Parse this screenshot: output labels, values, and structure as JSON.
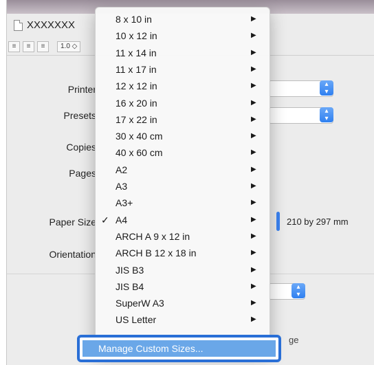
{
  "document": {
    "title": "XXXXXXX"
  },
  "toolbar": {
    "align_icons": [
      "align-left-icon",
      "align-center-icon",
      "align-right-icon"
    ],
    "line_spacing": "1.0 ◇"
  },
  "form": {
    "printer_label": "Printer",
    "presets_label": "Presets",
    "copies_label": "Copies",
    "pages_label": "Pages",
    "paper_size_label": "Paper Size",
    "orientation_label": "Orientation",
    "paper_size_dimensions": "210 by 297 mm",
    "obscured_text": "ge"
  },
  "paper_menu": {
    "items": [
      {
        "label": "8 x 10 in",
        "submenu": true,
        "checked": false
      },
      {
        "label": "10 x 12 in",
        "submenu": true,
        "checked": false
      },
      {
        "label": "11 x 14 in",
        "submenu": true,
        "checked": false
      },
      {
        "label": "11 x 17 in",
        "submenu": true,
        "checked": false
      },
      {
        "label": "12 x 12 in",
        "submenu": true,
        "checked": false
      },
      {
        "label": "16 x 20 in",
        "submenu": true,
        "checked": false
      },
      {
        "label": "17 x 22 in",
        "submenu": true,
        "checked": false
      },
      {
        "label": "30 x 40 cm",
        "submenu": true,
        "checked": false
      },
      {
        "label": "40 x 60 cm",
        "submenu": true,
        "checked": false
      },
      {
        "label": "A2",
        "submenu": true,
        "checked": false
      },
      {
        "label": "A3",
        "submenu": true,
        "checked": false
      },
      {
        "label": "A3+",
        "submenu": true,
        "checked": false
      },
      {
        "label": "A4",
        "submenu": true,
        "checked": true
      },
      {
        "label": "ARCH A 9 x 12 in",
        "submenu": true,
        "checked": false
      },
      {
        "label": "ARCH B 12 x 18 in",
        "submenu": true,
        "checked": false
      },
      {
        "label": "JIS B3",
        "submenu": true,
        "checked": false
      },
      {
        "label": "JIS B4",
        "submenu": true,
        "checked": false
      },
      {
        "label": "SuperW A3",
        "submenu": true,
        "checked": false
      },
      {
        "label": "US Letter",
        "submenu": true,
        "checked": false
      }
    ],
    "check_glyph": "✓",
    "arrow_glyph": "▶",
    "manage_label": "Manage Custom Sizes..."
  },
  "colors": {
    "highlight_border": "#2a6fd6",
    "selected_item": "#6aa7e8",
    "popup_button": "#2f80f0"
  }
}
